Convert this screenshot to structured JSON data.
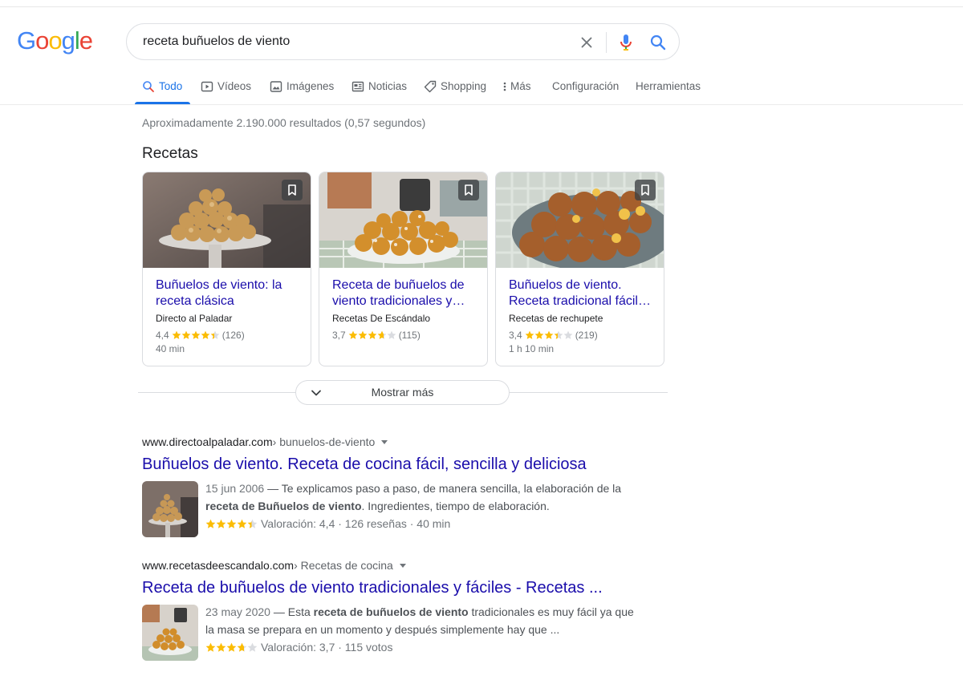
{
  "logo": {
    "letters": [
      "G",
      "o",
      "o",
      "g",
      "l",
      "e"
    ]
  },
  "search": {
    "value": "receta buñuelos de viento"
  },
  "tabs": [
    {
      "label": "Todo",
      "icon": "search-icon"
    },
    {
      "label": "Vídeos",
      "icon": "video-icon"
    },
    {
      "label": "Imágenes",
      "icon": "image-icon"
    },
    {
      "label": "Noticias",
      "icon": "news-icon"
    },
    {
      "label": "Shopping",
      "icon": "tag-icon"
    },
    {
      "label": "Más",
      "icon": "more-vert-icon"
    },
    {
      "label": "Configuración"
    },
    {
      "label": "Herramientas"
    }
  ],
  "stats": "Aproximadamente 2.190.000 resultados (0,57 segundos)",
  "recipes": {
    "title": "Recetas",
    "cards": [
      {
        "title": "Buñuelos de viento: la receta clásica",
        "source": "Directo al Paladar",
        "rating": "4,4",
        "rating_value": 4.4,
        "reviews": "(126)",
        "time": "40 min"
      },
      {
        "title": "Receta de buñuelos de viento tradicionales y…",
        "source": "Recetas De Escándalo",
        "rating": "3,7",
        "rating_value": 3.7,
        "reviews": "(115)",
        "time": ""
      },
      {
        "title": "Buñuelos de viento. Receta tradicional fácil…",
        "source": "Recetas de rechupete",
        "rating": "3,4",
        "rating_value": 3.4,
        "reviews": "(219)",
        "time": "1 h 10 min"
      }
    ],
    "more_label": "Mostrar más"
  },
  "results": [
    {
      "domain": "www.directoalpaladar.com",
      "crumb": " › bunuelos-de-viento",
      "title": "Buñuelos de viento. Receta de cocina fácil, sencilla y deliciosa",
      "date": "15 jun 2006",
      "snippet_a": " — Te explicamos paso a paso, de manera sencilla, la elaboración de la ",
      "snippet_bold": "receta de Buñuelos de viento",
      "snippet_b": ". Ingredientes, tiempo de elaboración.",
      "rating_value": 4.4,
      "rating_text": "Valoración: 4,4 · 126 reseñas · 40 min"
    },
    {
      "domain": "www.recetasdeescandalo.com",
      "crumb": " › Recetas de cocina",
      "title": "Receta de buñuelos de viento tradicionales y fáciles - Recetas ...",
      "date": "23 may 2020",
      "snippet_a": " — Esta ",
      "snippet_bold": "receta de buñuelos de viento",
      "snippet_b": " tradicionales es muy fácil ya que la masa se prepara en un momento y después simplemente hay que ...",
      "rating_value": 3.7,
      "rating_text": "Valoración: 3,7 · 115 votos"
    }
  ],
  "colors": {
    "link": "#1a0dab",
    "accent": "#1a73e8",
    "star": "#fbbc04",
    "star_empty": "#dadce0"
  }
}
